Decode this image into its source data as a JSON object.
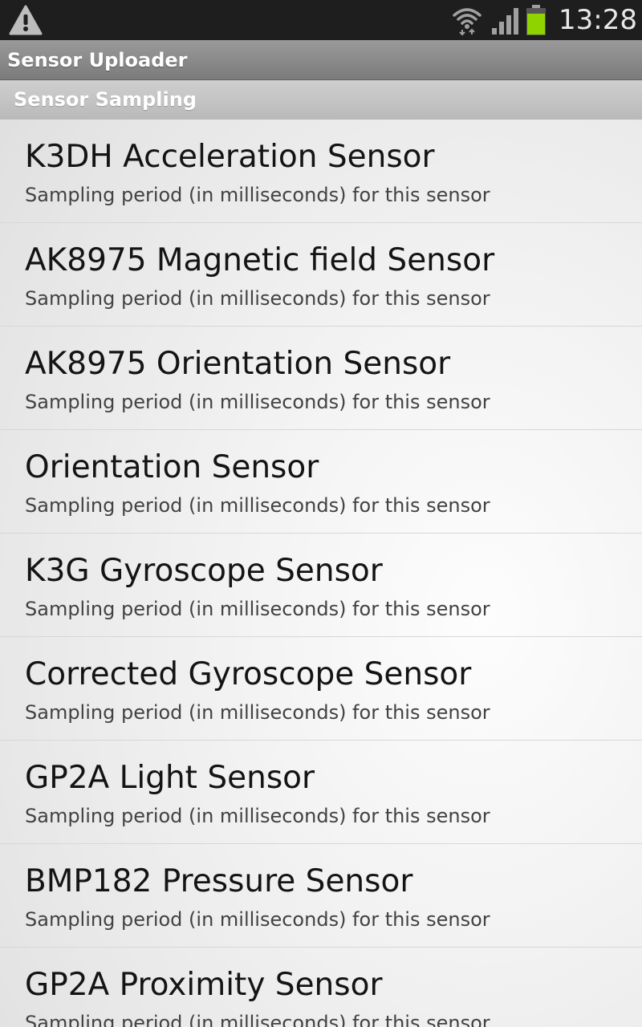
{
  "status_bar": {
    "time": "13:28",
    "icons": [
      "warning-icon",
      "wifi-icon",
      "signal-icon",
      "battery-icon"
    ],
    "battery_color": "#8fd400"
  },
  "app": {
    "title": "Sensor Uploader"
  },
  "category": {
    "title": "Sensor Sampling"
  },
  "preferences": [
    {
      "title": "K3DH Acceleration Sensor",
      "summary": "Sampling period (in milliseconds) for this sensor"
    },
    {
      "title": "AK8975 Magnetic field Sensor",
      "summary": "Sampling period (in milliseconds) for this sensor"
    },
    {
      "title": "AK8975 Orientation Sensor",
      "summary": "Sampling period (in milliseconds) for this sensor"
    },
    {
      "title": "Orientation Sensor",
      "summary": "Sampling period (in milliseconds) for this sensor"
    },
    {
      "title": "K3G Gyroscope Sensor",
      "summary": "Sampling period (in milliseconds) for this sensor"
    },
    {
      "title": "Corrected Gyroscope Sensor",
      "summary": "Sampling period (in milliseconds) for this sensor"
    },
    {
      "title": "GP2A Light Sensor",
      "summary": "Sampling period (in milliseconds) for this sensor"
    },
    {
      "title": "BMP182 Pressure Sensor",
      "summary": "Sampling period (in milliseconds) for this sensor"
    },
    {
      "title": "GP2A Proximity Sensor",
      "summary": "Sampling period (in milliseconds) for this sensor"
    }
  ]
}
